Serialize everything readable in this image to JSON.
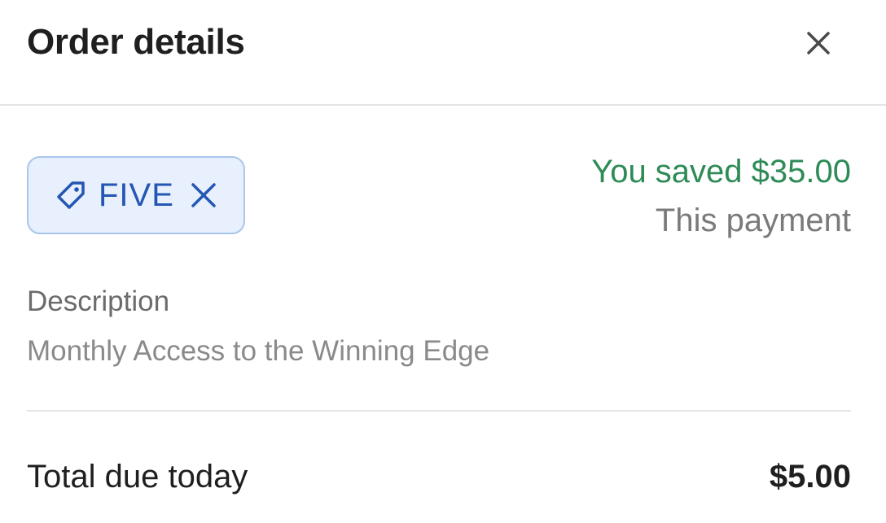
{
  "header": {
    "title": "Order details",
    "close_icon": "close-icon"
  },
  "coupon": {
    "icon": "tag-icon",
    "code": "FIVE",
    "remove_icon": "close-icon"
  },
  "savings": {
    "saved_text": "You saved $35.00",
    "period_text": "This payment"
  },
  "description": {
    "label": "Description",
    "value": "Monthly Access to the Winning Edge"
  },
  "total": {
    "label": "Total due today",
    "amount": "$5.00"
  },
  "colors": {
    "savings_green": "#2e8b57",
    "coupon_blue": "#2556b3",
    "coupon_bg": "#e7f0fc",
    "coupon_border": "#a9c6ec"
  }
}
